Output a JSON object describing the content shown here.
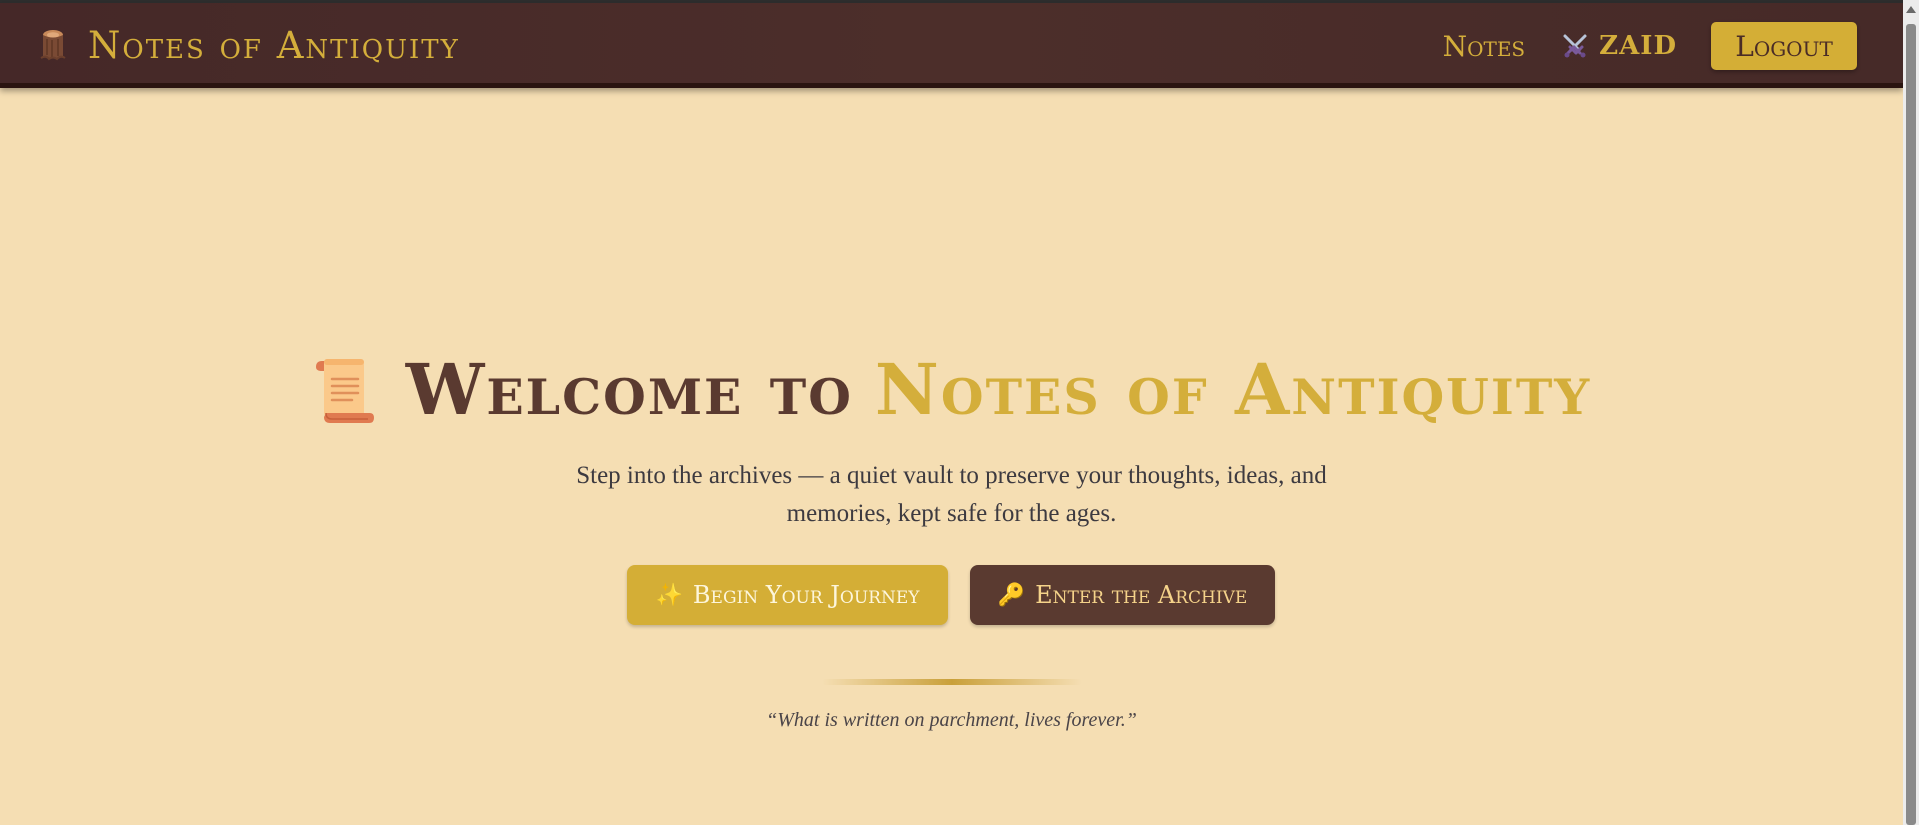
{
  "navbar": {
    "brand_icon": "tree-stump-icon",
    "brand_title": "Notes of Antiquity",
    "links": [
      {
        "label": "Notes"
      }
    ],
    "user": {
      "icon": "crossed-swords-icon",
      "name": "ZAID"
    },
    "logout_label": "Logout"
  },
  "hero": {
    "icon": "scroll-icon",
    "title_lead": "Welcome to",
    "title_accent": "Notes of Antiquity",
    "subtitle": "Step into the archives — a quiet vault to preserve your thoughts, ideas, and memories, kept safe for the ages.",
    "primary_button": {
      "icon": "sparkles-icon",
      "icon_glyph": "✨",
      "label": "Begin Your Journey"
    },
    "secondary_button": {
      "icon": "key-icon",
      "icon_glyph": "🔑",
      "label": "Enter the Archive"
    },
    "quote": "“What is written on parchment, lives forever.”"
  },
  "colors": {
    "background": "#f5deb3",
    "navbar": "#4a2c28",
    "gold": "#d4ae3b",
    "brown": "#5a3a30"
  }
}
